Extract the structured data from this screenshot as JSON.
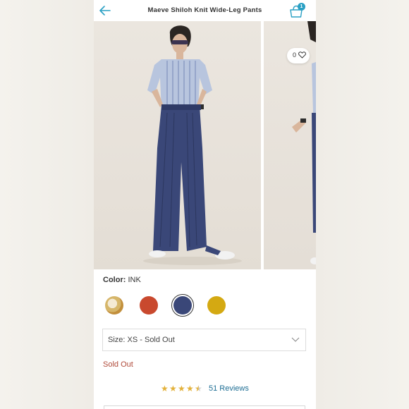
{
  "header": {
    "title": "Maeve Shiloh Knit Wide-Leg Pants",
    "bag_count": "1"
  },
  "gallery": {
    "favorite_count": "0"
  },
  "color": {
    "label": "Color:",
    "value": "INK",
    "swatches": [
      {
        "name": "floral-print",
        "color": "#d6b66a"
      },
      {
        "name": "rust",
        "color": "#c9492e"
      },
      {
        "name": "ink",
        "color": "#3a4778"
      },
      {
        "name": "mustard",
        "color": "#d4a912"
      }
    ],
    "selected": "ink"
  },
  "size": {
    "label": "Size:",
    "value": "XS - Sold Out"
  },
  "availability": "Sold Out",
  "reviews": {
    "rating": 4.5,
    "text": "51 Reviews"
  },
  "colors": {
    "accent_blue": "#2aa0c4",
    "sold_out_red": "#b04a3a",
    "star_gold": "#e3b13a",
    "link_blue": "#1e6e94"
  }
}
